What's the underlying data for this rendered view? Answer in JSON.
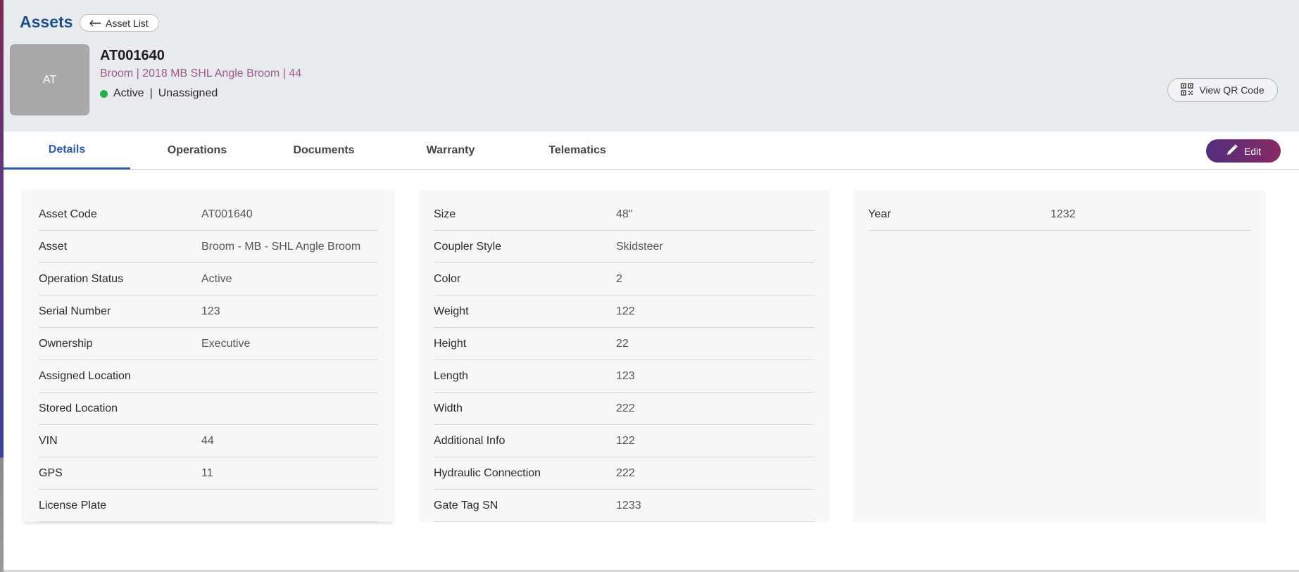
{
  "header": {
    "title": "Assets",
    "back_label": "Asset List",
    "avatar_initials": "AT",
    "asset_id": "AT001640",
    "subtitle": "Broom | 2018 MB SHL Angle Broom | 44",
    "status": "Active",
    "separator": "|",
    "assignment": "Unassigned",
    "status_color": "#22b04b",
    "qr_label": "View QR Code"
  },
  "tabs": [
    {
      "label": "Details",
      "active": true
    },
    {
      "label": "Operations",
      "active": false
    },
    {
      "label": "Documents",
      "active": false
    },
    {
      "label": "Warranty",
      "active": false
    },
    {
      "label": "Telematics",
      "active": false
    }
  ],
  "edit_label": "Edit",
  "cards": [
    {
      "rows": [
        {
          "label": "Asset Code",
          "value": "AT001640"
        },
        {
          "label": "Asset",
          "value": "Broom - MB - SHL Angle Broom"
        },
        {
          "label": "Operation Status",
          "value": "Active"
        },
        {
          "label": "Serial Number",
          "value": "123"
        },
        {
          "label": "Ownership",
          "value": "Executive"
        },
        {
          "label": "Assigned Location",
          "value": ""
        },
        {
          "label": "Stored Location",
          "value": ""
        },
        {
          "label": "VIN",
          "value": "44"
        },
        {
          "label": "GPS",
          "value": "11"
        },
        {
          "label": "License Plate",
          "value": ""
        }
      ]
    },
    {
      "rows": [
        {
          "label": "Size",
          "value": "48\""
        },
        {
          "label": "Coupler Style",
          "value": "Skidsteer"
        },
        {
          "label": "Color",
          "value": "2"
        },
        {
          "label": "Weight",
          "value": "122"
        },
        {
          "label": "Height",
          "value": "22"
        },
        {
          "label": "Length",
          "value": "123"
        },
        {
          "label": "Width",
          "value": "222"
        },
        {
          "label": "Additional Info",
          "value": "122"
        },
        {
          "label": "Hydraulic Connection",
          "value": "222"
        },
        {
          "label": "Gate Tag SN",
          "value": "1233"
        }
      ]
    },
    {
      "rows": [
        {
          "label": "Year",
          "value": "1232"
        }
      ]
    }
  ]
}
